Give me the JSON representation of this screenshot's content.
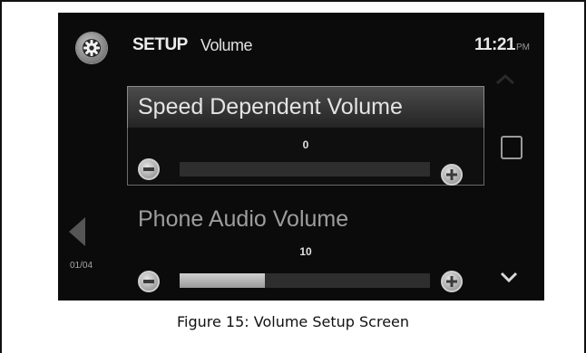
{
  "header": {
    "section": "SETUP",
    "page": "Volume",
    "time": "11:21",
    "ampm": "PM"
  },
  "items": [
    {
      "label": "Speed Dependent Volume",
      "value": "0",
      "level": 0,
      "selected": true
    },
    {
      "label": "Phone Audio Volume",
      "value": "10",
      "level": 0.34,
      "selected": false
    }
  ],
  "pagination": {
    "indicator": "01/04"
  },
  "caption": "Figure 15: Volume Setup Screen",
  "icons": {
    "setup": "gear-icon",
    "decrease": "minus-icon",
    "increase": "plus-icon",
    "scroll_up": "chevron-up-icon",
    "scroll_down": "chevron-down-icon",
    "previous": "triangle-left-icon"
  },
  "colors": {
    "screen_background": "#0b0b0b",
    "slider_fill": "#bdbdbd",
    "track": "#2e2e2e"
  }
}
